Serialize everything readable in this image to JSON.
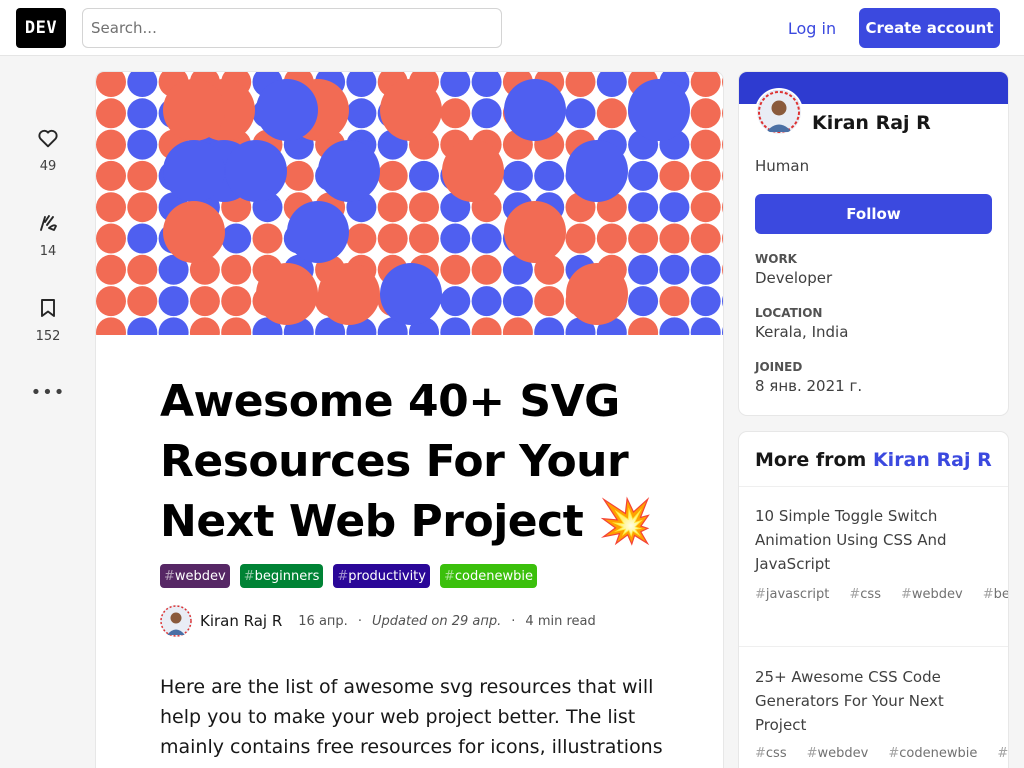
{
  "header": {
    "logo_text": "DEV",
    "search_placeholder": "Search...",
    "login_label": "Log in",
    "create_account_label": "Create account"
  },
  "reactions": {
    "hearts": "49",
    "unicorns": "14",
    "bookmarks": "152",
    "more_label": "•••"
  },
  "article": {
    "title": "Awesome 40+ SVG Resources For Your Next Web Project 💥",
    "tags": [
      {
        "label": "webdev",
        "color": "#562765"
      },
      {
        "label": "beginners",
        "color": "#008335"
      },
      {
        "label": "productivity",
        "color": "#2a0798"
      },
      {
        "label": "codenewbie",
        "color": "#3bc00c"
      }
    ],
    "author": "Kiran Raj R",
    "date": "16 апр.",
    "updated": "Updated on 29 апр.",
    "read_time": "4 min read",
    "body": "Here are the list of awesome svg resources that will help you to make your web project better. The list mainly contains free resources for icons, illustrations for landing"
  },
  "profile": {
    "name": "Kiran Raj R",
    "bio": "Human",
    "follow_label": "Follow",
    "work_label": "WORK",
    "work": "Developer",
    "location_label": "LOCATION",
    "location": "Kerala, India",
    "joined_label": "JOINED",
    "joined": "8 янв. 2021 г."
  },
  "more_from": {
    "prefix": "More from",
    "author": "Kiran Raj R",
    "posts": [
      {
        "title": "10 Simple Toggle Switch Animation Using CSS And JavaScript",
        "tags": [
          "javascript",
          "css",
          "webdev",
          "beginners"
        ]
      },
      {
        "title": "25+ Awesome CSS Code Generators For Your Next Project",
        "tags": [
          "css",
          "webdev",
          "codenewbie",
          "beginners"
        ]
      }
    ]
  },
  "colors": {
    "accent": "#3b49df",
    "cover_blue": "#4f5ff0",
    "cover_coral": "#f26b54"
  }
}
